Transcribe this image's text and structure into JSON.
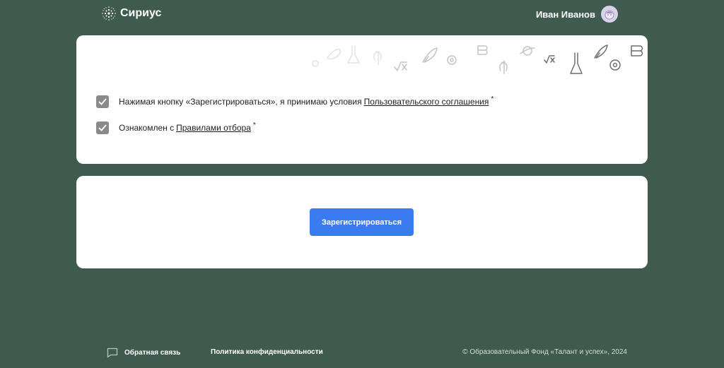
{
  "brand": {
    "name": "Сириус",
    "logo_icon": "sirius-dots-logo"
  },
  "user": {
    "name": "Иван Иванов",
    "avatar_icon": "avatar-face"
  },
  "agreements": [
    {
      "checked": true,
      "text": "Нажимая кнопку «Зарегистрироваться», я принимаю условия",
      "link": "Пользовательского соглашения",
      "required_mark": "*"
    },
    {
      "checked": true,
      "text": "Ознакомлен с",
      "link": "Правилами отбора",
      "required_mark": "*"
    }
  ],
  "register_button": {
    "label": "Зарегистрироваться",
    "color": "#3a7cf0"
  },
  "footer": {
    "feedback": "Обратная связь",
    "privacy": "Политика конфиденциальности",
    "copyright": "© Образовательный Фонд «Талант и успех», 2024"
  },
  "colors": {
    "background": "#3f5b50",
    "card": "#ffffff",
    "checkbox": "#8a8a8a"
  }
}
